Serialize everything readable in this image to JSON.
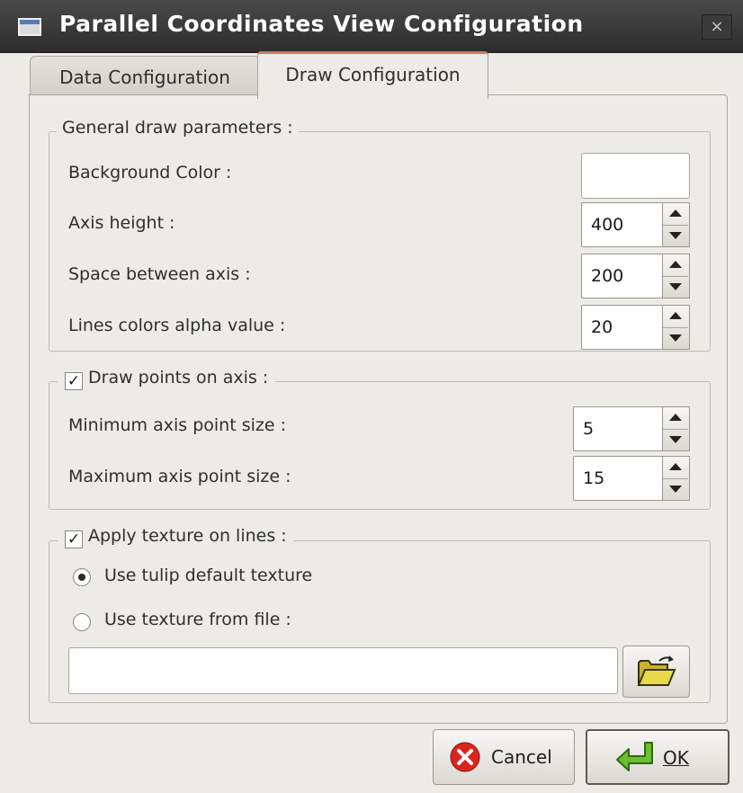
{
  "window": {
    "title": "Parallel Coordinates View Configuration",
    "close_glyph": "×"
  },
  "tabs": [
    {
      "label": "Data Configuration",
      "active": false
    },
    {
      "label": "Draw Configuration",
      "active": true
    }
  ],
  "general": {
    "title": "General draw parameters :",
    "background_color_label": "Background Color :",
    "background_color_value": "#ffffff",
    "axis_height_label": "Axis height :",
    "axis_height_value": "400",
    "space_between_axis_label": "Space between axis :",
    "space_between_axis_value": "200",
    "alpha_label": "Lines colors alpha value :",
    "alpha_value": "20"
  },
  "points": {
    "checkbox_label": "Draw points on axis :",
    "checked": true,
    "check_glyph": "✓",
    "min_label": "Minimum axis point size :",
    "min_value": "5",
    "max_label": "Maximum axis point size :",
    "max_value": "15"
  },
  "texture": {
    "checkbox_label": "Apply texture on lines :",
    "checked": true,
    "check_glyph": "✓",
    "radio_default_label": "Use tulip default texture",
    "radio_file_label": "Use texture from file :",
    "selected": "default",
    "file_path": ""
  },
  "buttons": {
    "cancel_label": "Cancel",
    "ok_label": "OK",
    "cancel_icon": "cancel-icon",
    "ok_icon": "enter-arrow-icon",
    "folder_icon": "open-folder-icon"
  },
  "colors": {
    "titlebar": "#2c2c2c",
    "tab_accent": "#c97a5c",
    "cancel_red": "#d9261c",
    "ok_green": "#6abf2e",
    "folder_yellow": "#d8c43a"
  }
}
